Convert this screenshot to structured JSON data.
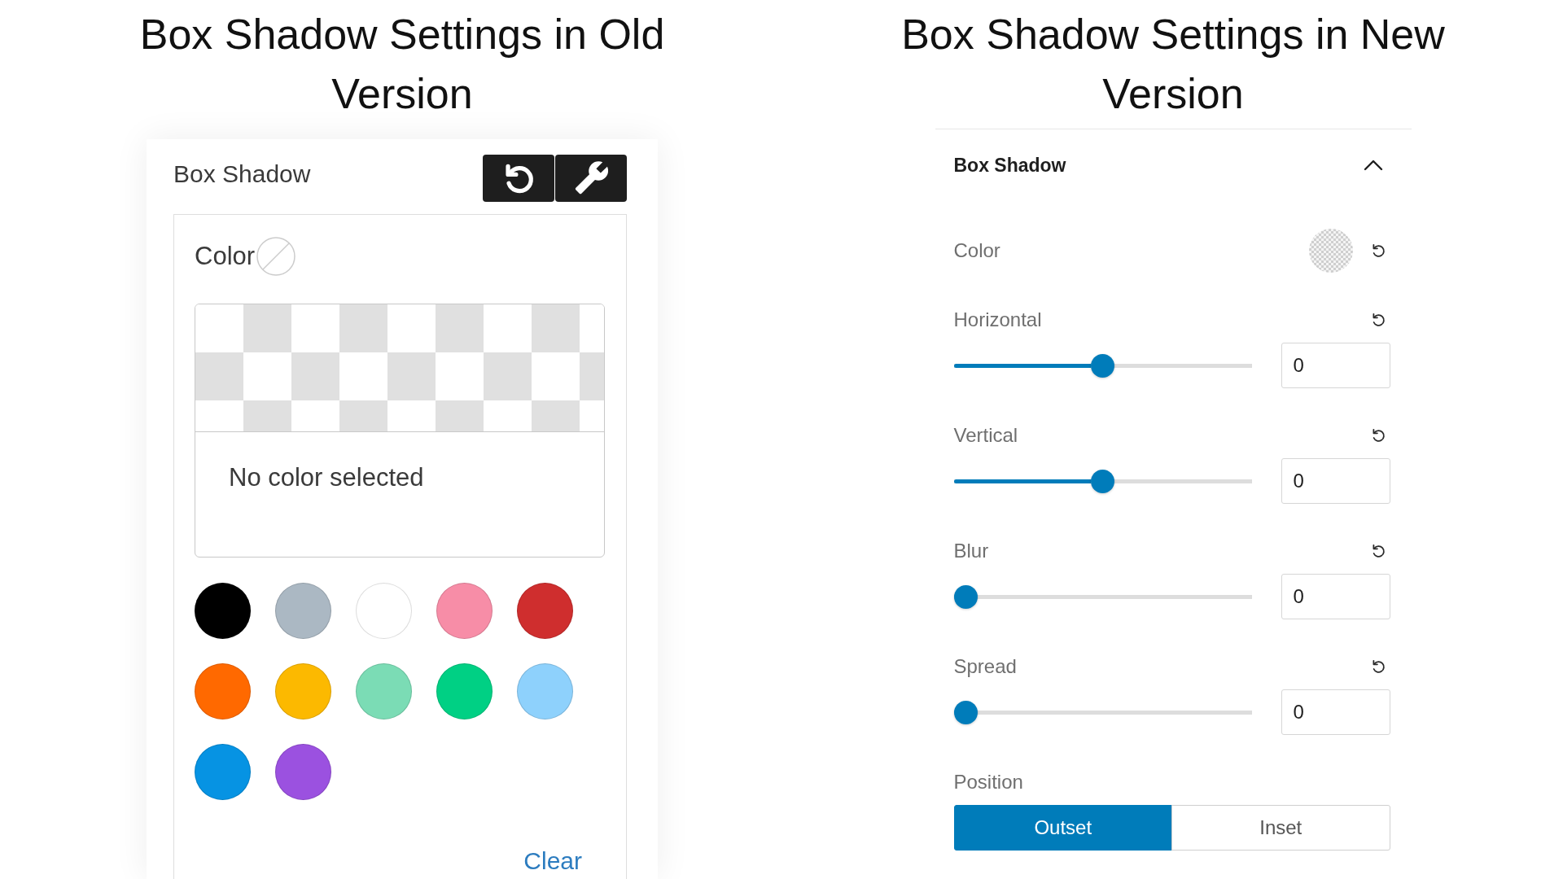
{
  "old_version": {
    "title": "Box Shadow Settings in Old Version",
    "panel": {
      "label": "Box Shadow",
      "color_label": "Color",
      "preview_text": "No color selected",
      "swatches": [
        {
          "color": "#000000",
          "selected": false
        },
        {
          "color": "#abb8c3",
          "selected": false
        },
        {
          "color": "#ffffff",
          "selected": false
        },
        {
          "color": "#f78da7",
          "selected": false
        },
        {
          "color": "#cf2e2e",
          "selected": false
        },
        {
          "color": "#ff6900",
          "selected": false
        },
        {
          "color": "#fcb900",
          "selected": false
        },
        {
          "color": "#7bdcb5",
          "selected": false
        },
        {
          "color": "#00d084",
          "selected": false
        },
        {
          "color": "#8ed1fc",
          "selected": false
        },
        {
          "color": "#0693e3",
          "selected": false
        },
        {
          "color": "#9b51e0",
          "selected": false
        }
      ],
      "clear_link": "Clear"
    }
  },
  "new_version": {
    "title": "Box Shadow Settings in New Version",
    "panel": {
      "title": "Box Shadow",
      "expanded": true,
      "color_label": "Color",
      "controls": [
        {
          "label": "Horizontal",
          "level": 0.5,
          "value": "0"
        },
        {
          "label": "Vertical",
          "level": 0.5,
          "value": "0"
        },
        {
          "label": "Blur",
          "level": 0,
          "value": "0"
        },
        {
          "label": "Spread",
          "level": 0,
          "value": "0"
        }
      ],
      "position": {
        "label": "Position",
        "options": [
          {
            "label": "Outset",
            "selected": true
          },
          {
            "label": "Inset",
            "selected": false
          }
        ]
      }
    }
  }
}
